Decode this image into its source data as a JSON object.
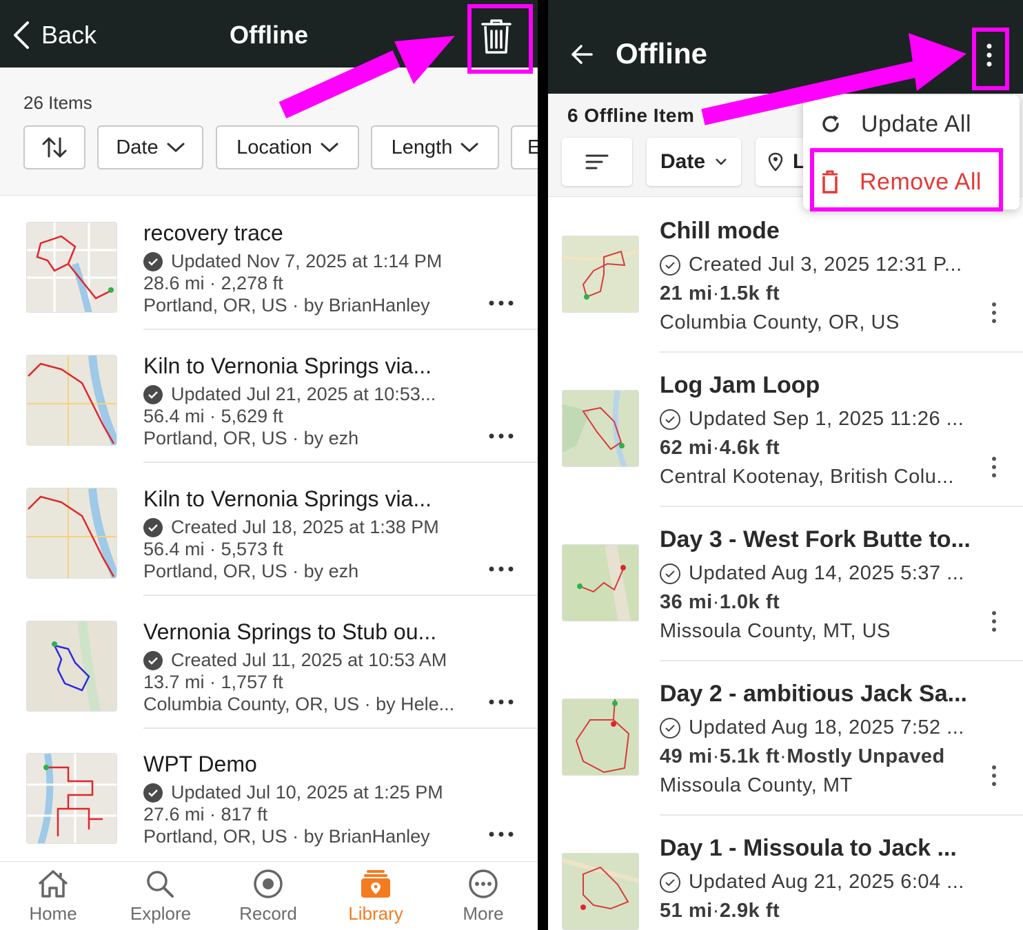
{
  "left": {
    "header": {
      "back_label": "Back",
      "title": "Offline"
    },
    "count_label": "26 Items",
    "filters": [
      "Date",
      "Location",
      "Length",
      "E"
    ],
    "items": [
      {
        "title": "recovery trace",
        "status": "Updated Nov 7, 2025 at 1:14 PM",
        "stats": "28.6 mi · 2,278 ft",
        "location": "Portland, OR, US · by BrianHanley"
      },
      {
        "title": "Kiln to Vernonia Springs via...",
        "status": "Updated Jul 21, 2025 at 10:53...",
        "stats": "56.4 mi · 5,629 ft",
        "location": "Portland, OR, US · by ezh"
      },
      {
        "title": "Kiln to Vernonia Springs via...",
        "status": "Created Jul 18, 2025 at 1:38 PM",
        "stats": "56.4 mi · 5,573 ft",
        "location": "Portland, OR, US · by ezh"
      },
      {
        "title": "Vernonia Springs to Stub ou...",
        "status": "Created Jul 11, 2025 at 10:53 AM",
        "stats": "13.7 mi · 1,757 ft",
        "location": "Columbia County, OR, US · by Hele..."
      },
      {
        "title": "WPT Demo",
        "status": "Updated Jul 10, 2025 at 1:25 PM",
        "stats": "27.6 mi · 817 ft",
        "location": "Portland, OR, US · by BrianHanley"
      }
    ],
    "tabs": [
      {
        "label": "Home",
        "icon": "home-icon"
      },
      {
        "label": "Explore",
        "icon": "search-icon"
      },
      {
        "label": "Record",
        "icon": "record-icon"
      },
      {
        "label": "Library",
        "icon": "library-icon"
      },
      {
        "label": "More",
        "icon": "more-icon"
      }
    ],
    "active_tab": "Library"
  },
  "right": {
    "header": {
      "title": "Offline"
    },
    "count_label": "6 Offline Item",
    "filters": [
      "Date",
      "L"
    ],
    "menu": {
      "update_all": "Update All",
      "remove_all": "Remove All"
    },
    "items": [
      {
        "title": "Chill mode",
        "status": "Created Jul 3, 2025 12:31 P...",
        "distance": "21 mi",
        "gain": "1.5k ft",
        "surface": "",
        "location": "Columbia County, OR, US"
      },
      {
        "title": "Log Jam Loop",
        "status": "Updated Sep 1, 2025 11:26 ...",
        "distance": "62 mi",
        "gain": "4.6k ft",
        "surface": "",
        "location": "Central Kootenay, British Colu..."
      },
      {
        "title": "Day 3 - West Fork Butte to...",
        "status": "Updated Aug 14, 2025 5:37 ...",
        "distance": "36 mi",
        "gain": "1.0k ft",
        "surface": "",
        "location": "Missoula County, MT, US"
      },
      {
        "title": "Day 2 - ambitious Jack Sa...",
        "status": "Updated Aug 18, 2025 7:52 ...",
        "distance": "49 mi",
        "gain": "5.1k ft",
        "surface": "Mostly Unpaved",
        "location": "Missoula County, MT"
      },
      {
        "title": "Day 1 - Missoula to Jack ...",
        "status": "Updated Aug 21, 2025 6:04 ...",
        "distance": "51 mi",
        "gain": "2.9k ft",
        "surface": "",
        "location": ""
      }
    ]
  },
  "colors": {
    "header_bg": "#1b2422",
    "accent_orange": "#f47b20",
    "annotation_magenta": "#ff00ff",
    "remove_red": "#e53935"
  }
}
